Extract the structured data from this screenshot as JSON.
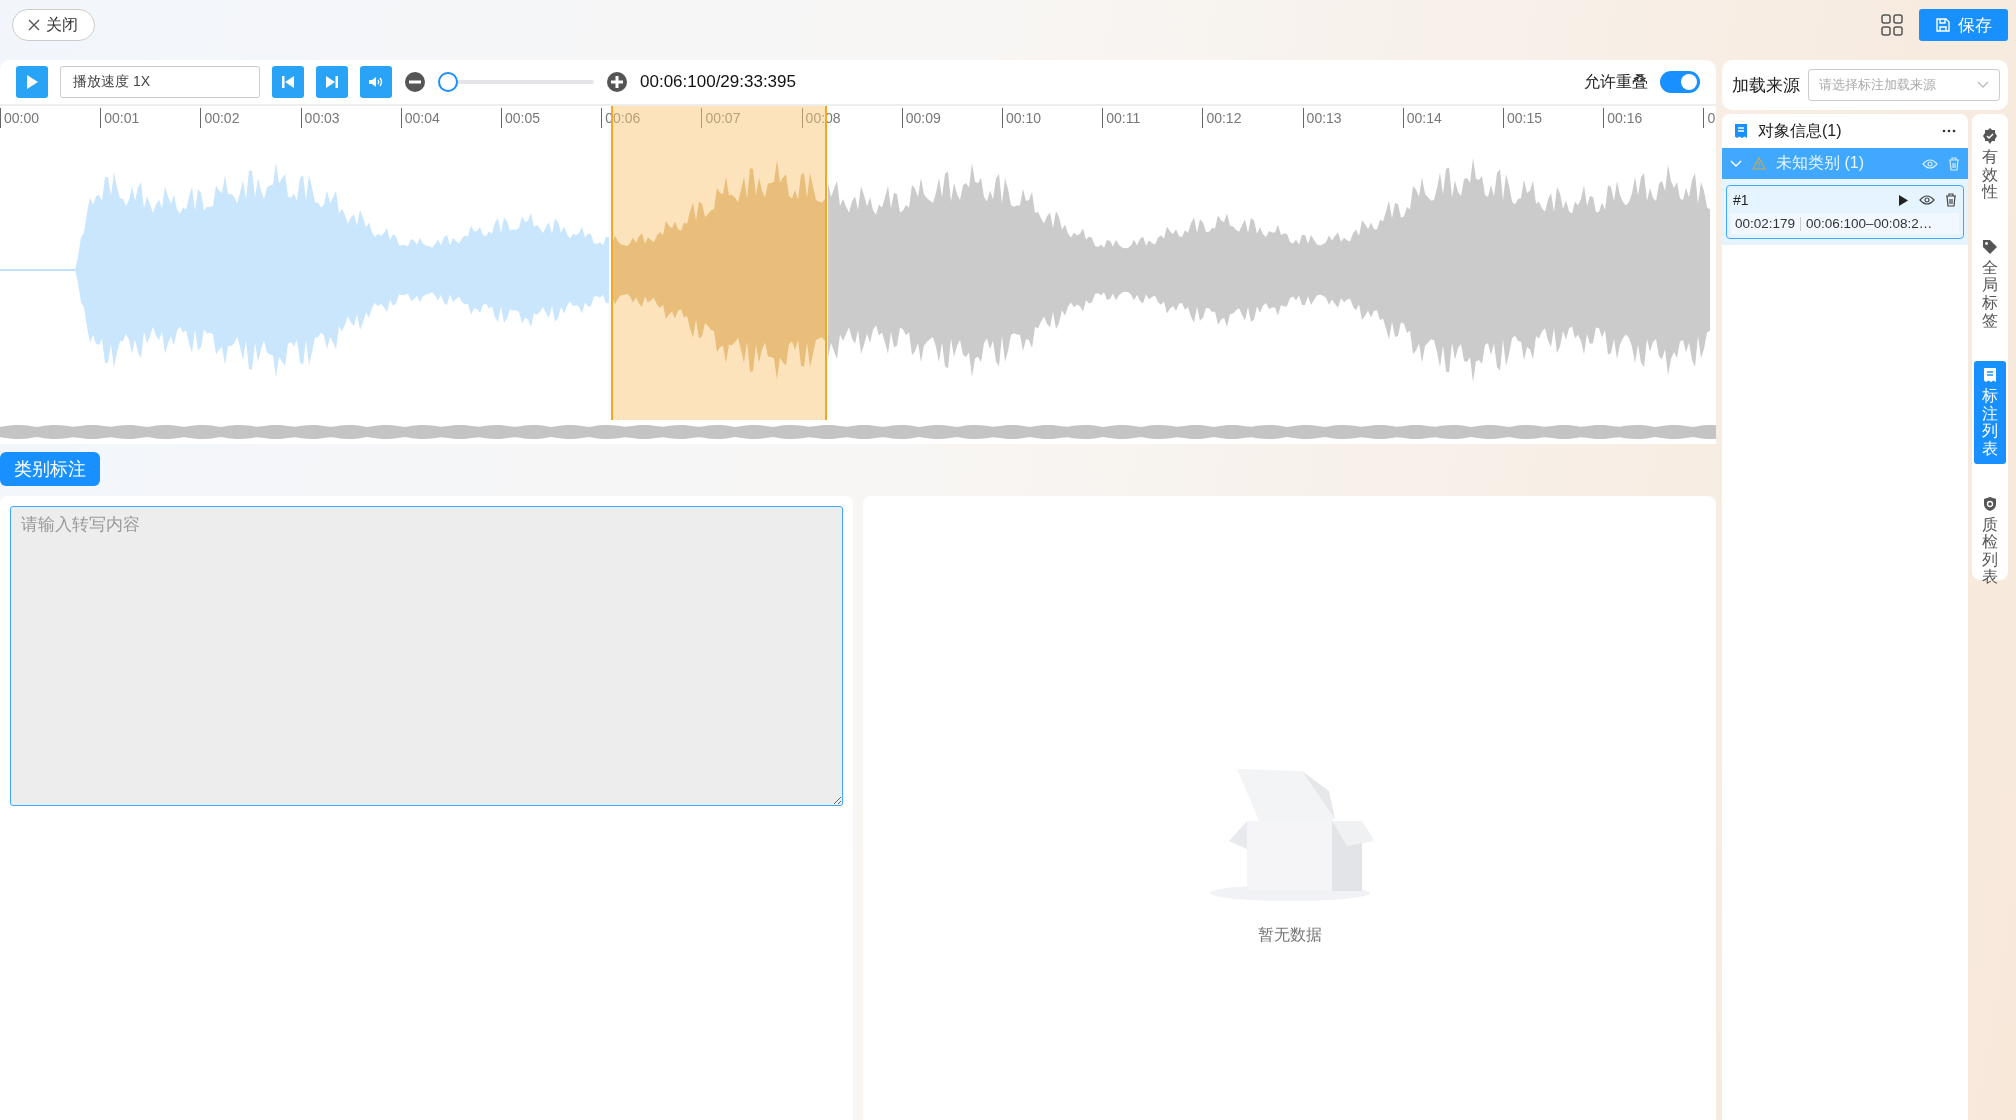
{
  "top_bar": {
    "close_label": "关闭",
    "save_label": "保存"
  },
  "player": {
    "speed": "播放速度 1X",
    "zoom": {
      "level": 0
    },
    "time": "00:06:100/29:33:395",
    "overlap": {
      "label": "允许重叠",
      "on": true
    }
  },
  "timeline": {
    "ticks": [
      "00:00",
      "00:01",
      "00:02",
      "00:03",
      "00:04",
      "00:05",
      "00:06",
      "00:07",
      "00:08",
      "00:09",
      "00:10",
      "00:11",
      "00:12",
      "00:13",
      "00:14",
      "00:15",
      "00:16",
      "0"
    ]
  },
  "tag": "类别标注",
  "transcript": {
    "placeholder": "请输入转写内容"
  },
  "empty_state": {
    "text": "暂无数据"
  },
  "source": {
    "label": "加载来源",
    "placeholder": "请选择标注加载来源"
  },
  "objects": {
    "title": "对象信息(1)",
    "groups": [
      {
        "label": "未知类别 (1)",
        "expanded": true,
        "items": [
          {
            "id": "#1",
            "duration": "00:02:179",
            "range": "00:06:100–00:08:2…",
            "selected": true
          }
        ]
      }
    ]
  },
  "side_tabs": [
    {
      "kind": "check",
      "label": "有效性",
      "selected": false
    },
    {
      "kind": "tag",
      "label": "全局标签",
      "selected": false
    },
    {
      "kind": "list",
      "label": "标注列表",
      "selected": true
    },
    {
      "kind": "shield",
      "label": "质检列表",
      "selected": false
    }
  ]
}
